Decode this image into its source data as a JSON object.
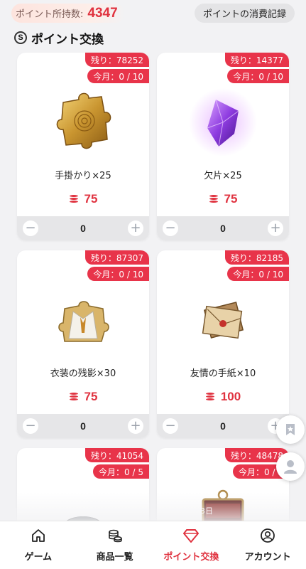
{
  "header": {
    "points_label": "ポイント所持数:",
    "points_value": "4347",
    "history_button": "ポイントの消費記録"
  },
  "section": {
    "icon_glyph": "S",
    "title": "ポイント交換"
  },
  "items": [
    {
      "stock": "残り：78252",
      "monthly": "今月：0 / 10",
      "name": "手掛かり×25",
      "price": "75",
      "quantity": "0",
      "icon": "golden-puzzle-piece-icon"
    },
    {
      "stock": "残り：14377",
      "monthly": "今月：0 / 10",
      "name": "欠片×25",
      "price": "75",
      "quantity": "0",
      "icon": "purple-crystal-icon"
    },
    {
      "stock": "残り：87307",
      "monthly": "今月：0 / 10",
      "name": "衣装の残影×30",
      "price": "75",
      "quantity": "0",
      "icon": "costume-puzzle-icon"
    },
    {
      "stock": "残り：82185",
      "monthly": "今月：0 / 10",
      "name": "友情の手紙×10",
      "price": "100",
      "quantity": "0",
      "icon": "friendship-letter-icon"
    },
    {
      "stock": "残り：41054",
      "monthly": "今月：0 / 5",
      "name": "",
      "price": "",
      "quantity": "",
      "icon": "lens-icon"
    },
    {
      "stock": "残り：48478",
      "monthly": "今月：0 / 1",
      "name": "",
      "price": "",
      "quantity": "",
      "icon": "pass-3day-icon",
      "tag": "3日"
    }
  ],
  "stepper": {
    "minus": "−",
    "plus": "+"
  },
  "nav": {
    "items": [
      {
        "label": "ゲーム",
        "icon": "home-icon"
      },
      {
        "label": "商品一覧",
        "icon": "coins-icon"
      },
      {
        "label": "ポイント交換",
        "icon": "gem-icon"
      },
      {
        "label": "アカウント",
        "icon": "account-icon"
      }
    ],
    "active_index": 2
  },
  "colors": {
    "accent": "#e0323f",
    "badge": "#e8344a",
    "background": "#f2f2f4"
  }
}
